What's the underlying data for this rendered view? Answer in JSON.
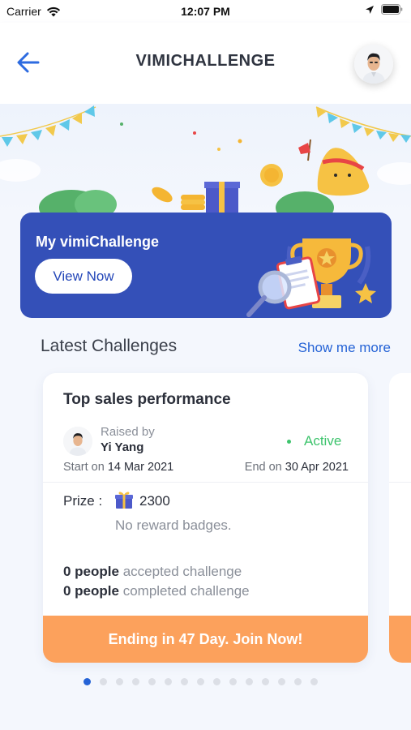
{
  "status_bar": {
    "carrier": "Carrier",
    "time": "12:07 PM"
  },
  "header": {
    "title": "VIMICHALLENGE",
    "back_icon": "arrow-left-icon"
  },
  "banner": {
    "title": "My vimiChallenge",
    "button_label": "View Now"
  },
  "section": {
    "title": "Latest Challenges",
    "more_link": "Show me more"
  },
  "challenge": {
    "title": "Top sales performance",
    "raised_by_label": "Raised by",
    "raiser_name": "Yi Yang",
    "status": "Active",
    "start_label": "Start on",
    "start_date": "14 Mar 2021",
    "end_label": "End on",
    "end_date": "30 Apr 2021",
    "prize_label": "Prize :",
    "prize_value": "2300",
    "badges_text": "No reward badges.",
    "accepted_count": "0 people",
    "accepted_label": "accepted challenge",
    "completed_count": "0 people",
    "completed_label": "completed challenge",
    "cta_label": "Ending in 47 Day. Join Now!"
  },
  "pager": {
    "total": 15,
    "active_index": 0
  },
  "colors": {
    "primary": "#2563d6",
    "banner": "#3450b8",
    "active": "#3ec46d",
    "cta": "#fca15c"
  }
}
